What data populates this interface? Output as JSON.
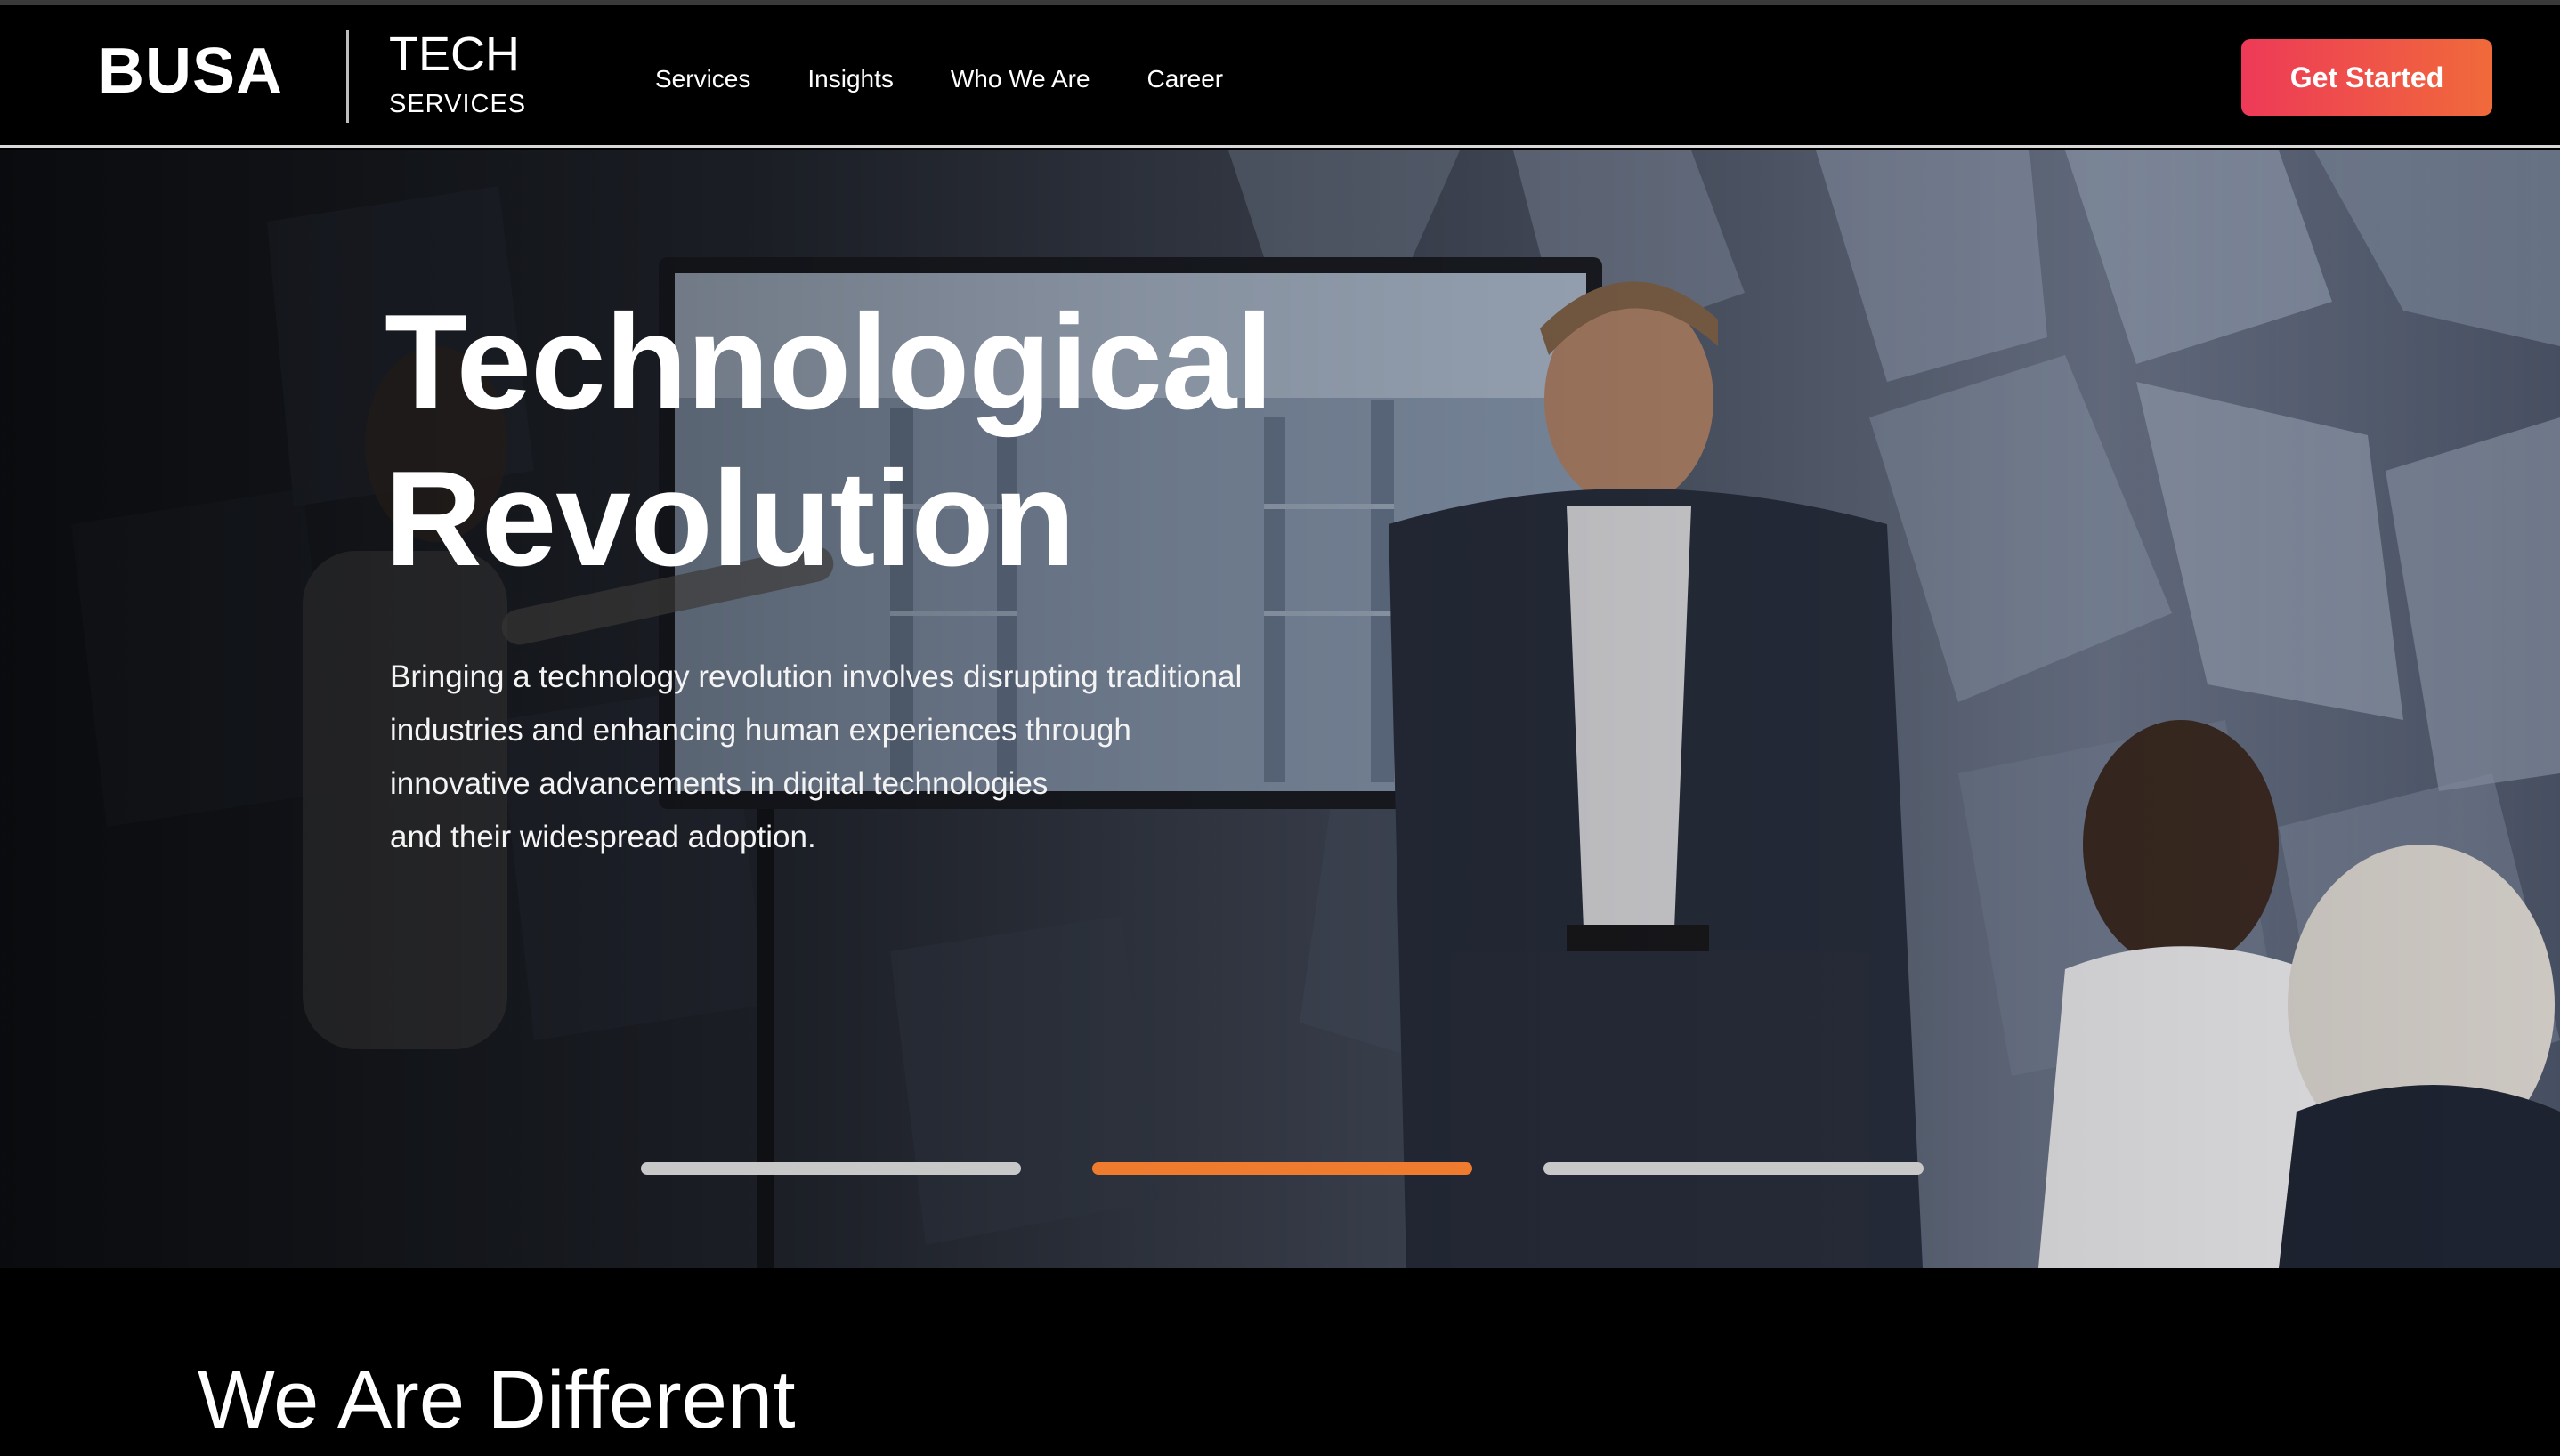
{
  "header": {
    "brand": "BUSA",
    "brand_sub_top": "TECH",
    "brand_sub_bottom": "SERVICES",
    "nav": [
      {
        "label": "Services"
      },
      {
        "label": "Insights"
      },
      {
        "label": "Who We Are"
      },
      {
        "label": "Career"
      }
    ],
    "cta_label": "Get Started"
  },
  "hero": {
    "title_line1": "Technological",
    "title_line2": "Revolution",
    "desc_line1": "Bringing a technology revolution involves disrupting traditional",
    "desc_line2": "industries and enhancing human experiences through",
    "desc_line3": "innovative advancements in digital technologies",
    "desc_line4": "and their widespread adoption.",
    "slides_total": 3,
    "active_slide": 2
  },
  "section": {
    "title": "We Are Different"
  },
  "colors": {
    "cta_start": "#ee3a58",
    "cta_end": "#f06a3a",
    "active_indicator": "#ef7b2e",
    "inactive_indicator": "#c8c8c8"
  }
}
